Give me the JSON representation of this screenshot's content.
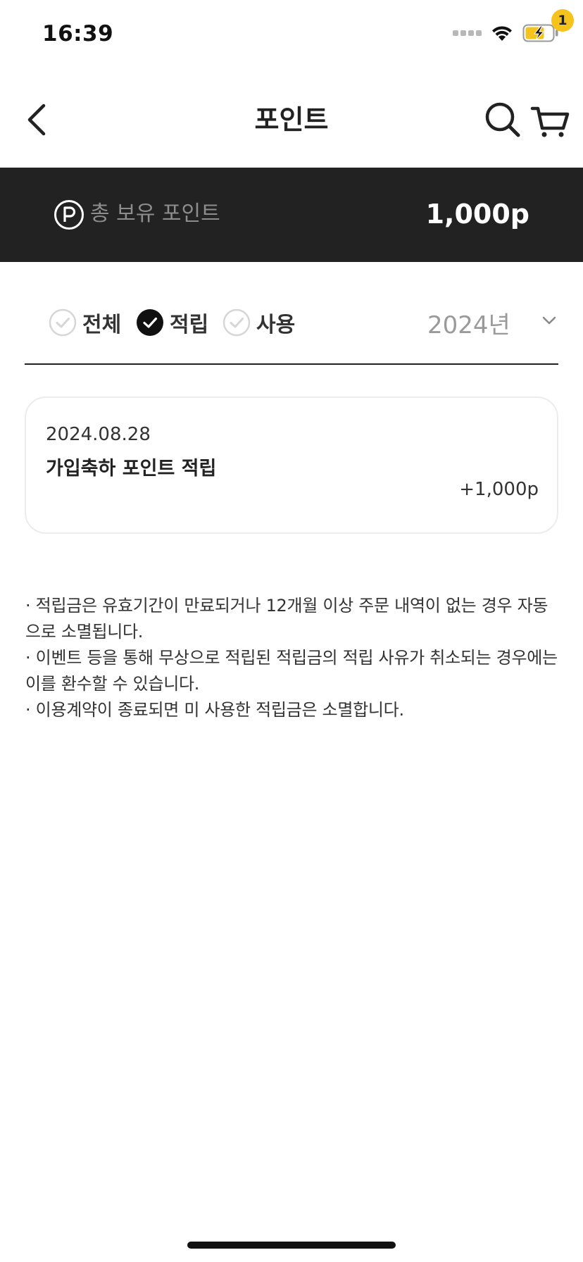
{
  "status_bar": {
    "time": "16:39",
    "icons": [
      "signal-icon",
      "wifi-icon",
      "battery-charging-icon"
    ]
  },
  "header": {
    "title": "포인트",
    "cart_count": "1",
    "icons": [
      "back-chevron-icon",
      "search-icon",
      "cart-icon"
    ]
  },
  "points": {
    "label": "총 보유 포인트",
    "value": "1,000p",
    "icon": "points-p-icon"
  },
  "filters": {
    "items": [
      {
        "label": "전체",
        "checked": false
      },
      {
        "label": "적립",
        "checked": true
      },
      {
        "label": "사용",
        "checked": false
      }
    ],
    "year": "2024년"
  },
  "history": [
    {
      "date": "2024.08.28",
      "title": "가입축하 포인트 적립",
      "amount": "+1,000p"
    }
  ],
  "notice": [
    "· 적립금은 유효기간이 만료되거나 12개월 이상 주문 내역이 없는 경우 자동으로 소멸됩니다.",
    "· 이벤트 등을 통해 무상으로 적립된 적립금의 적립 사유가 취소되는 경우에는 이를 환수할 수 있습니다.",
    "· 이용계약이 종료되면 미 사용한 적립금은 소멸합니다."
  ],
  "colors": {
    "banner_bg": "#222222",
    "badge": "#f6c21c",
    "battery_fill": "#f6c21c"
  }
}
